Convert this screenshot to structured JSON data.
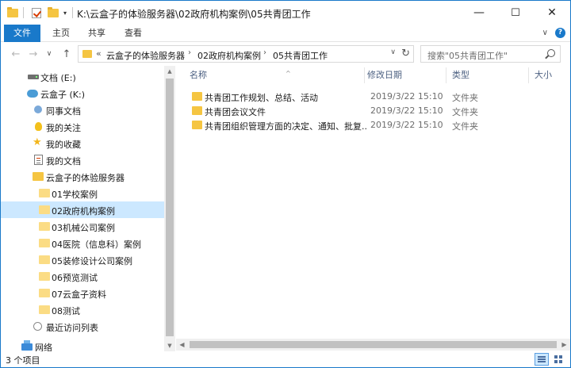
{
  "window": {
    "title": "K:\\云盒子的体验服务器\\02政府机构案例\\05共青团工作",
    "minimize": "—",
    "maximize": "☐",
    "close": "✕"
  },
  "quick_access": {
    "dropdown": "▾"
  },
  "ribbon": {
    "tabs": [
      "文件",
      "主页",
      "共享",
      "查看"
    ],
    "expand": "∨",
    "help": "?"
  },
  "navigation": {
    "back": "←",
    "forward": "→",
    "recent": "∨",
    "up": "↑",
    "address_prefix": "«",
    "breadcrumbs": [
      "云盒子的体验服务器",
      "02政府机构案例",
      "05共青团工作"
    ],
    "breadcrumb_separator": "›",
    "address_dropdown": "∨",
    "refresh": "↻",
    "search_placeholder": "搜索\"05共青团工作\""
  },
  "nav_pane": {
    "items": [
      {
        "label": "文档 (E:)",
        "icon": "drive-icon",
        "level": 1
      },
      {
        "label": "云盒子 (K:)",
        "icon": "cloud-drive-icon",
        "level": 1
      },
      {
        "label": "同事文档",
        "icon": "colleague-docs-icon",
        "level": 2
      },
      {
        "label": "我的关注",
        "icon": "bulb-icon",
        "level": 2
      },
      {
        "label": "我的收藏",
        "icon": "star-icon",
        "level": 2
      },
      {
        "label": "我的文档",
        "icon": "document-icon",
        "level": 2
      },
      {
        "label": "云盒子的体验服务器",
        "icon": "folder-icon",
        "level": 2
      },
      {
        "label": "01学校案例",
        "icon": "folder-icon",
        "level": 3
      },
      {
        "label": "02政府机构案例",
        "icon": "folder-icon",
        "level": 3,
        "selected": true
      },
      {
        "label": "03机械公司案例",
        "icon": "folder-icon",
        "level": 3
      },
      {
        "label": "04医院（信息科）案例",
        "icon": "folder-icon",
        "level": 3
      },
      {
        "label": "05装修设计公司案例",
        "icon": "folder-icon",
        "level": 3
      },
      {
        "label": "06预览测试",
        "icon": "folder-icon",
        "level": 3
      },
      {
        "label": "07云盒子资料",
        "icon": "folder-icon",
        "level": 3
      },
      {
        "label": "08测试",
        "icon": "folder-icon",
        "level": 3
      },
      {
        "label": "最近访问列表",
        "icon": "clock-icon",
        "level": 2
      },
      {
        "label": "网络",
        "icon": "network-icon",
        "level": 1
      }
    ]
  },
  "file_list": {
    "columns": [
      "名称",
      "修改日期",
      "类型",
      "大小"
    ],
    "sort_indicator": "^",
    "rows": [
      {
        "name": "共青团工作规划、总结、活动",
        "date": "2019/3/22 15:10",
        "type": "文件夹"
      },
      {
        "name": "共青团会议文件",
        "date": "2019/3/22 15:10",
        "type": "文件夹"
      },
      {
        "name": "共青团组织管理方面的决定、通知、批复...",
        "date": "2019/3/22 15:10",
        "type": "文件夹"
      }
    ]
  },
  "scrollbars": {
    "up": "▲",
    "down": "▼",
    "left": "◀",
    "right": "▶"
  },
  "status": {
    "item_count": "3 个项目"
  }
}
